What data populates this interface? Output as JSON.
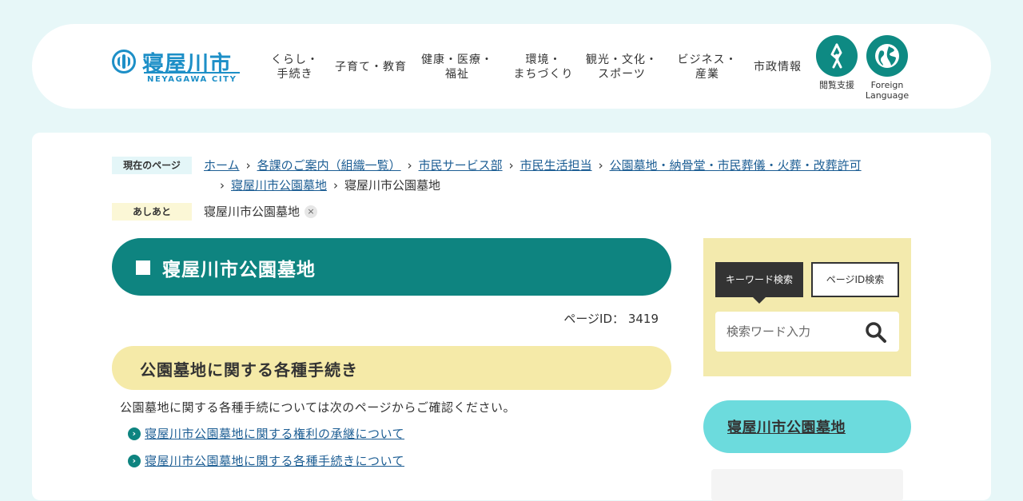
{
  "header": {
    "logo_text": "寝屋川市",
    "logo_sub": "NEYAGAWA CITY",
    "nav": [
      {
        "label": "くらし・\n手続き"
      },
      {
        "label": "子育て・教育"
      },
      {
        "label": "健康・医療・\n福祉"
      },
      {
        "label": "環境・\nまちづくり"
      },
      {
        "label": "観光・文化・\nスポーツ"
      },
      {
        "label": "ビジネス・\n産業"
      },
      {
        "label": "市政情報"
      }
    ],
    "accessibility_label": "閲覧支援",
    "language_label": "Foreign\nLanguage",
    "accent_color": "#0e8a83"
  },
  "breadcrumb": {
    "label": "現在のページ",
    "items": [
      "ホーム",
      "各課のご案内（組織一覧）",
      "市民サービス部",
      "市民生活担当",
      "公園墓地・納骨堂・市民葬儀・火葬・改葬許可",
      "寝屋川市公園墓地"
    ],
    "current": "寝屋川市公園墓地"
  },
  "ashiato": {
    "label": "あしあと",
    "item": "寝屋川市公園墓地",
    "close": "×"
  },
  "page": {
    "title": "寝屋川市公園墓地",
    "page_id_label": "ページID：",
    "page_id": "3419",
    "section_title": "公園墓地に関する各種手続き",
    "section_text": "公園墓地に関する各種手続については次のページからご確認ください。",
    "links": [
      "寝屋川市公園墓地に関する権利の承継について",
      "寝屋川市公園墓地に関する各種手続きについて"
    ]
  },
  "sidebar": {
    "tab_keyword": "キーワード検索",
    "tab_page_id": "ページID検索",
    "search_placeholder": "検索ワード入力",
    "section_title": "寝屋川市公園墓地"
  }
}
